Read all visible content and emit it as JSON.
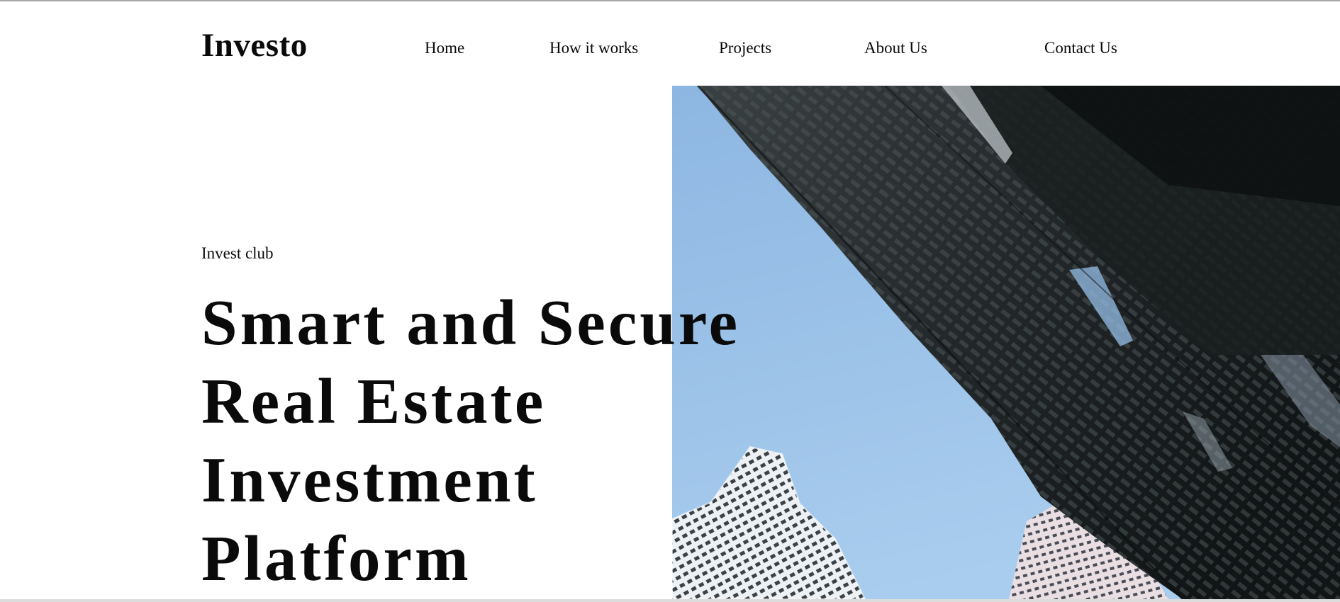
{
  "header": {
    "logo": "Investo",
    "nav": [
      {
        "label": "Home"
      },
      {
        "label": "How it works"
      },
      {
        "label": "Projects"
      },
      {
        "label": "About Us"
      },
      {
        "label": "Contact Us"
      }
    ]
  },
  "hero": {
    "eyebrow": "Invest club",
    "headline_lines": [
      "Smart and Secure",
      "Real Estate",
      "Investment",
      "Platform"
    ],
    "image": "skyscrapers-looking-up-photo"
  },
  "colors": {
    "text": "#0a0a0a",
    "background": "#ffffff",
    "sky": "#9fc3e8",
    "building_dark": "#1d2122"
  }
}
